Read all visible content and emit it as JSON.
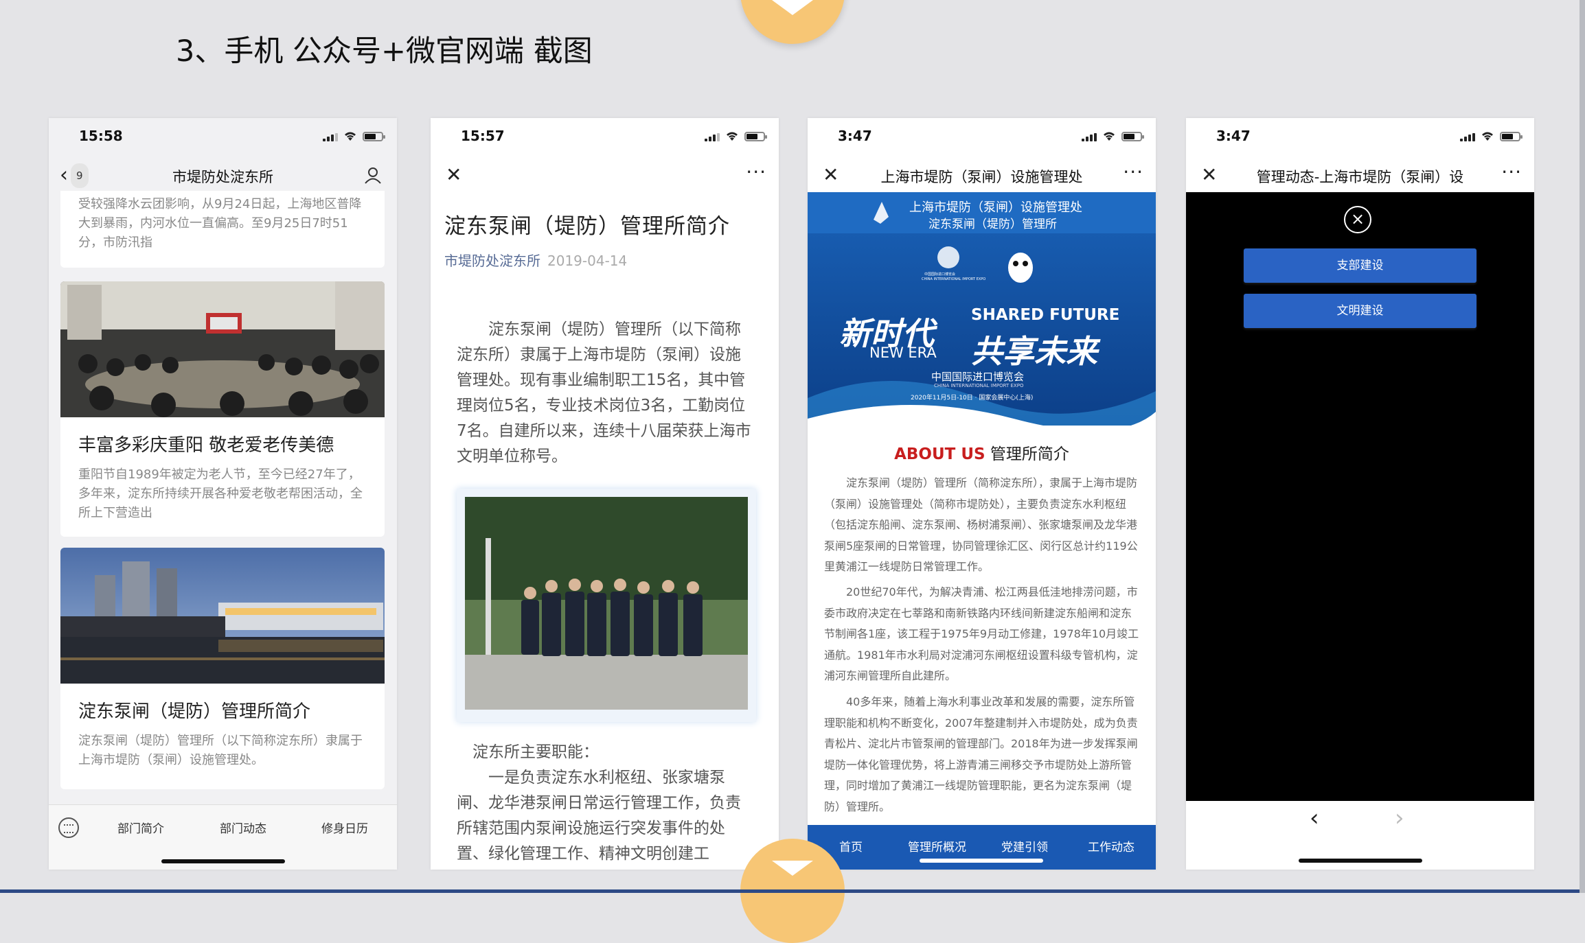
{
  "slide": {
    "title": "3、手机 公众号+微官网端 截图"
  },
  "phone1": {
    "time": "15:58",
    "back_icon": "chevron-left-icon",
    "back_badge": "9",
    "title": "市堤防处淀东所",
    "profile_icon": "person-icon",
    "card1_text": "受较强降水云团影响，从9月24日起，上海地区普降大到暴雨，内河水位一直偏高。至9月25日7时51分，市防汛指",
    "card2_title": "丰富多彩庆重阳 敬老爱老传美德",
    "card2_text": "重阳节自1989年被定为老人节，至今已经27年了，多年来，淀东所持续开展各种爱老敬老帮困活动，全所上下营造出",
    "card3_title": "淀东泵闸（堤防）管理所简介",
    "card3_text": "淀东泵闸（堤防）管理所（以下简称淀东所）隶属于上海市堤防（泵闸）设施管理处。",
    "tabs": [
      "部门简介",
      "部门动态",
      "修身日历"
    ]
  },
  "phone2": {
    "time": "15:57",
    "close_icon": "close-icon",
    "more_icon": "more-icon",
    "article_title": "淀东泵闸（堤防）管理所简介",
    "source": "市堤防处淀东所",
    "date": "2019-04-14",
    "para1": "淀东泵闸（堤防）管理所（以下简称淀东所）隶属于上海市堤防（泵闸）设施管理处。现有事业编制职工15名，其中管理岗位5名，专业技术岗位3名，工勤岗位7名。自建所以来，连续十八届荣获上海市文明单位称号。",
    "para2": "淀东所主要职能：",
    "para3": "一是负责淀东水利枢纽、张家塘泵闸、龙华港泵闸日常运行管理工作，负责所辖范围内泵闸设施运行突发事件的处置、绿化管理工作、精神文明创建工"
  },
  "phone3": {
    "time": "3:47",
    "title": "上海市堤防（泵闸）设施管理处",
    "banner_org1": "上海市堤防（泵闸）设施管理处",
    "banner_org2": "淀东泵闸（堤防）管理所",
    "banner_cn": "新时代",
    "banner_cn2": "共享未来",
    "banner_en1": "SHARED FUTURE",
    "banner_en2": "NEW ERA",
    "banner_expo": "中国国际进口博览会",
    "banner_expo_en": "CHINA INTERNATIONAL IMPORT EXPO",
    "banner_date": "2020年11月5日-10日 · 国家会展中心(上海)",
    "logo_cn": "中国国际进口博览会",
    "logo_en": "CHINA INTERNATIONAL IMPORT EXPO",
    "about_en": "ABOUT US",
    "about_cn": "管理所简介",
    "p1": "淀东泵闸（堤防）管理所（简称淀东所），隶属于上海市堤防（泵闸）设施管理处（简称市堤防处），主要负责淀东水利枢纽（包括淀东船闸、淀东泵闸、杨树浦泵闸）、张家塘泵闸及龙华港泵闸5座泵闸的日常管理，协同管理徐汇区、闵行区总计约119公里黄浦江一线堤防日常管理工作。",
    "p2": "20世纪70年代，为解决青浦、松江两县低洼地排涝问题，市委市政府决定在七莘路和南新铁路内环线间新建淀东船闸和淀东节制闸各1座，该工程于1975年9月动工修建，1978年10月竣工通航。1981年市水利局对淀浦河东闸枢纽设置科级专管机构，淀浦河东闸管理所自此建所。",
    "p3": "40多年来，随着上海水利事业改革和发展的需要，淀东所管理职能和机构不断变化，2007年整建制并入市堤防处，成为负责青松片、淀北片市管泵闸的管理部门。2018年为进一步发挥泵闸堤防一体化管理优势，将上游青浦三闸移交予市堤防处上游所管理，同时增加了黄浦江一线堤防管理职能，更名为淀东泵闸（堤防）管理所。",
    "tabs": [
      "首页",
      "管理所概况",
      "党建引领",
      "工作动态"
    ]
  },
  "phone4": {
    "time": "3:47",
    "title": "管理动态-上海市堤防（泵闸）设",
    "btn1": "支部建设",
    "btn2": "文明建设",
    "back_icon": "chevron-left-icon",
    "forward_icon": "chevron-right-icon"
  }
}
